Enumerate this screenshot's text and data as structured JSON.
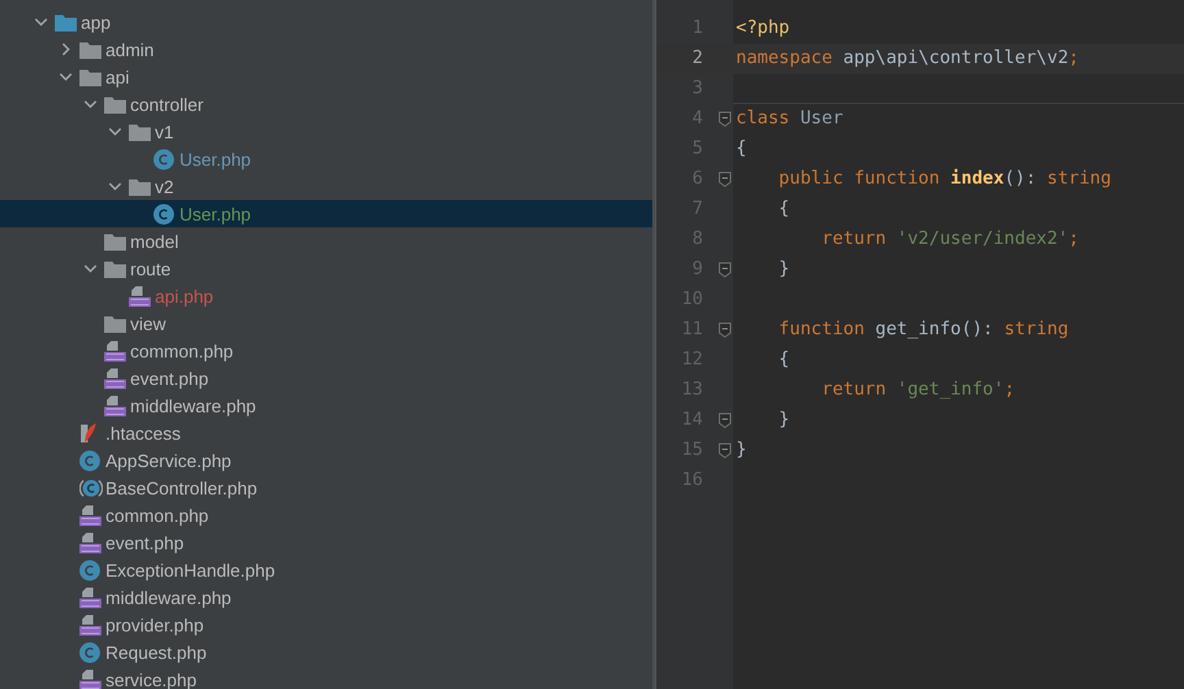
{
  "project_tree": [
    {
      "name": "app",
      "kind": "module-folder",
      "expanded": true,
      "selected": false,
      "children": [
        {
          "name": "admin",
          "kind": "folder",
          "expanded": false,
          "selected": false
        },
        {
          "name": "api",
          "kind": "folder",
          "expanded": true,
          "selected": false,
          "children": [
            {
              "name": "controller",
              "kind": "folder",
              "expanded": true,
              "selected": false,
              "children": [
                {
                  "name": "v1",
                  "kind": "folder",
                  "expanded": true,
                  "selected": false,
                  "children": [
                    {
                      "name": "User.php",
                      "kind": "class",
                      "selected": false,
                      "color": "#6897bb"
                    }
                  ]
                },
                {
                  "name": "v2",
                  "kind": "folder",
                  "expanded": true,
                  "selected": false,
                  "children": [
                    {
                      "name": "User.php",
                      "kind": "class",
                      "selected": true,
                      "color": "#629755"
                    }
                  ]
                }
              ]
            },
            {
              "name": "model",
              "kind": "folder",
              "selected": false
            },
            {
              "name": "route",
              "kind": "folder",
              "expanded": true,
              "selected": false,
              "children": [
                {
                  "name": "api.php",
                  "kind": "php",
                  "selected": false,
                  "color": "#c75450"
                }
              ]
            },
            {
              "name": "view",
              "kind": "folder",
              "selected": false
            },
            {
              "name": "common.php",
              "kind": "php",
              "selected": false
            },
            {
              "name": "event.php",
              "kind": "php",
              "selected": false
            },
            {
              "name": "middleware.php",
              "kind": "php",
              "selected": false
            }
          ]
        },
        {
          "name": ".htaccess",
          "kind": "htaccess",
          "selected": false
        },
        {
          "name": "AppService.php",
          "kind": "class",
          "selected": false
        },
        {
          "name": "BaseController.php",
          "kind": "abstract-class",
          "selected": false
        },
        {
          "name": "common.php",
          "kind": "php",
          "selected": false
        },
        {
          "name": "event.php",
          "kind": "php",
          "selected": false
        },
        {
          "name": "ExceptionHandle.php",
          "kind": "class",
          "selected": false
        },
        {
          "name": "middleware.php",
          "kind": "php",
          "selected": false
        },
        {
          "name": "provider.php",
          "kind": "php",
          "selected": false
        },
        {
          "name": "Request.php",
          "kind": "class",
          "selected": false
        },
        {
          "name": "service.php",
          "kind": "php",
          "selected": false
        }
      ]
    }
  ],
  "editor": {
    "lines": [
      {
        "number": "1",
        "current": false,
        "fold": false,
        "tokens": [
          {
            "kind": "tag",
            "text": "<?php"
          }
        ]
      },
      {
        "number": "2",
        "current": true,
        "fold": false,
        "tokens": [
          {
            "kind": "keyword",
            "text": "namespace "
          },
          {
            "kind": "ident",
            "text": "app\\api\\controller\\v2"
          },
          {
            "kind": "keyword",
            "text": ";"
          }
        ]
      },
      {
        "number": "3",
        "current": false,
        "fold": false
      },
      {
        "number": "4",
        "current": false,
        "fold": true,
        "tokens": [
          {
            "kind": "keyword",
            "text": "class "
          },
          {
            "kind": "class-name",
            "text": "User"
          }
        ]
      },
      {
        "number": "5",
        "current": false,
        "fold": false,
        "tokens": [
          {
            "kind": "plain",
            "text": "{"
          }
        ]
      },
      {
        "number": "6",
        "current": false,
        "fold": true,
        "tokens": [
          {
            "kind": "keyword",
            "text": "    public function "
          },
          {
            "kind": "function",
            "text": "index"
          },
          {
            "kind": "plain",
            "text": "(): "
          },
          {
            "kind": "keyword",
            "text": "string"
          }
        ]
      },
      {
        "number": "7",
        "current": false,
        "fold": false,
        "tokens": [
          {
            "kind": "plain",
            "text": "    {"
          }
        ]
      },
      {
        "number": "8",
        "current": false,
        "fold": false,
        "tokens": [
          {
            "kind": "keyword",
            "text": "        return "
          },
          {
            "kind": "string",
            "text": "'v2/user/index2'"
          },
          {
            "kind": "keyword",
            "text": ";"
          }
        ]
      },
      {
        "number": "9",
        "current": false,
        "fold": true,
        "tokens": [
          {
            "kind": "plain",
            "text": "    }"
          }
        ]
      },
      {
        "number": "10",
        "current": false,
        "fold": false
      },
      {
        "number": "11",
        "current": false,
        "fold": true,
        "tokens": [
          {
            "kind": "keyword",
            "text": "    function "
          },
          {
            "kind": "ident",
            "text": "get_info"
          },
          {
            "kind": "plain",
            "text": "(): "
          },
          {
            "kind": "keyword",
            "text": "string"
          }
        ]
      },
      {
        "number": "12",
        "current": false,
        "fold": false,
        "tokens": [
          {
            "kind": "plain",
            "text": "    {"
          }
        ]
      },
      {
        "number": "13",
        "current": false,
        "fold": false,
        "tokens": [
          {
            "kind": "keyword",
            "text": "        return "
          },
          {
            "kind": "string",
            "text": "'get_info'"
          },
          {
            "kind": "keyword",
            "text": ";"
          }
        ]
      },
      {
        "number": "14",
        "current": false,
        "fold": true,
        "tokens": [
          {
            "kind": "plain",
            "text": "    }"
          }
        ]
      },
      {
        "number": "15",
        "current": false,
        "fold": true,
        "tokens": [
          {
            "kind": "plain",
            "text": "}"
          }
        ]
      },
      {
        "number": "16",
        "current": false,
        "fold": false
      }
    ]
  }
}
